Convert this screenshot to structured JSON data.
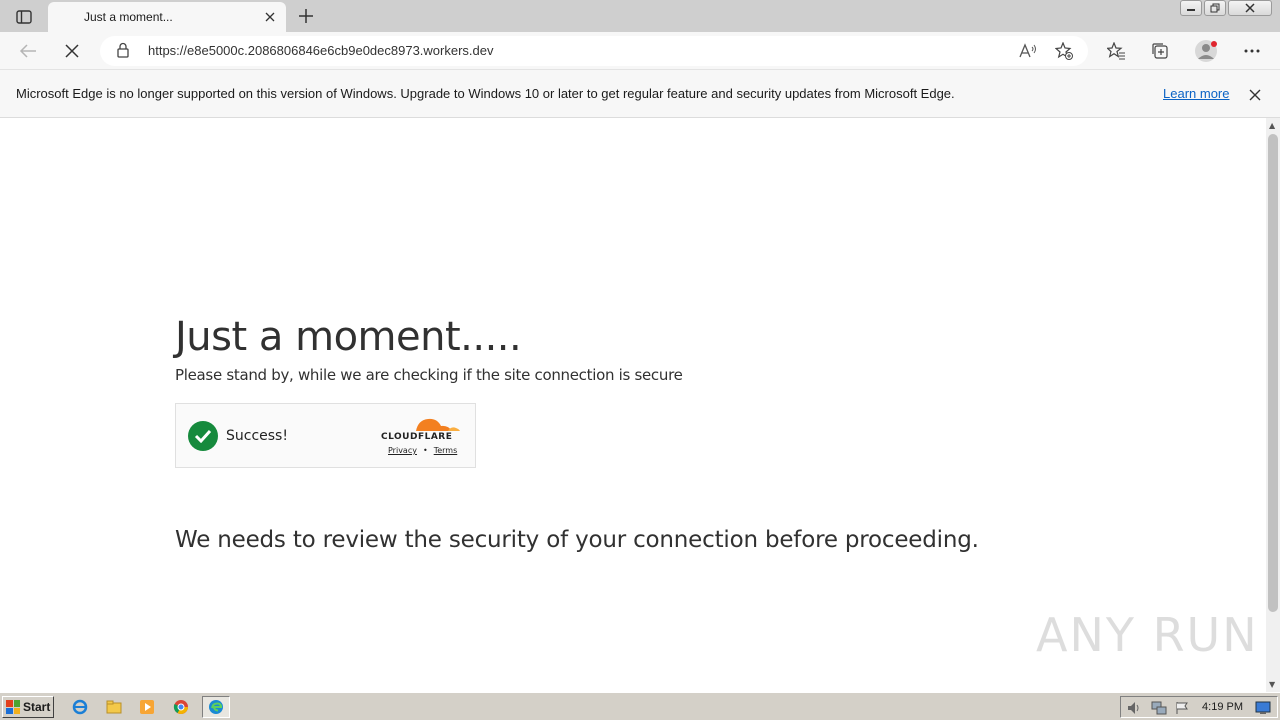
{
  "browser": {
    "tab_title": "Just a moment...",
    "url": "https://e8e5000c.2086806846e6cb9e0dec8973.workers.dev"
  },
  "infobar": {
    "message": "Microsoft Edge is no longer supported on this version of Windows. Upgrade to Windows 10 or later to get regular feature and security updates from Microsoft Edge.",
    "link": "Learn more"
  },
  "page": {
    "heading": "Just a moment.....",
    "subheading": "Please stand by, while we are checking if the site connection is secure",
    "widget": {
      "status": "Success!",
      "brand": "CLOUDFLARE",
      "privacy": "Privacy",
      "terms": "Terms",
      "separator": "•"
    },
    "review_text": "We needs to review the security of your connection before proceeding."
  },
  "watermark": "ANY RUN",
  "taskbar": {
    "start_label": "Start",
    "clock": "4:19 PM"
  },
  "colors": {
    "success_green": "#168a3d",
    "cloudflare_orange": "#f38020",
    "link_blue": "#0b63c5"
  }
}
